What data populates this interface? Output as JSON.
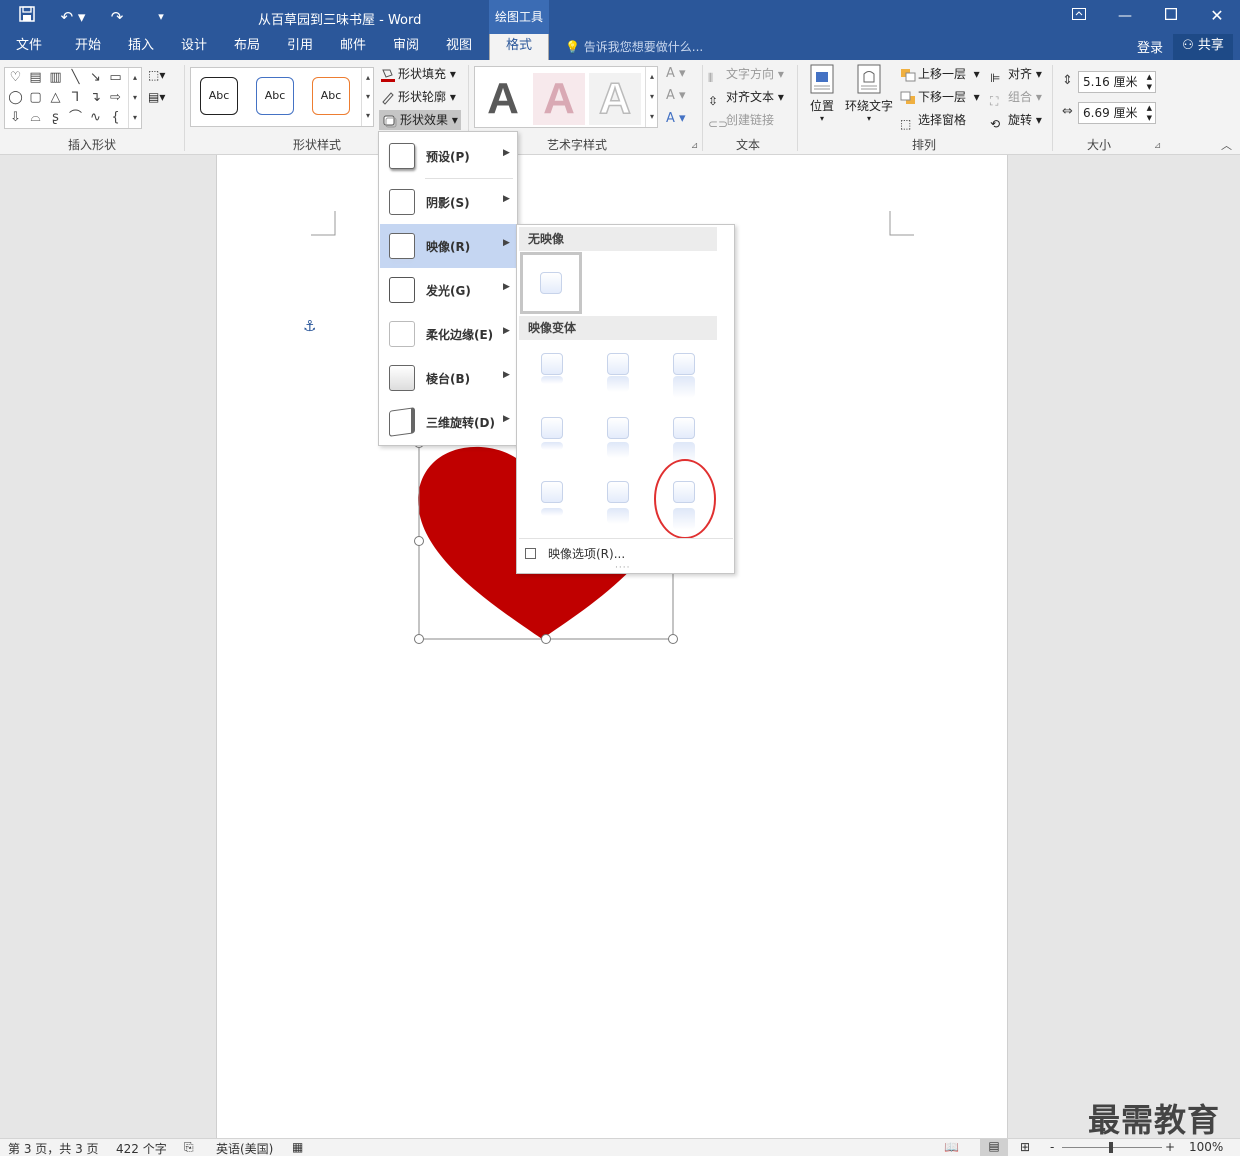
{
  "app": {
    "title": "从百草园到三味书屋 - Word",
    "context_tab_label": "绘图工具",
    "colors": {
      "brand": "#2b579a",
      "heart": "#c00000",
      "menu_highlight": "#c5d6f2",
      "annotation_circle": "#e03030"
    }
  },
  "quick_access": {
    "save_icon": "save-icon",
    "undo_icon": "undo-icon",
    "redo_icon": "redo-icon",
    "customize_icon": "customize-icon"
  },
  "tabs": [
    "文件",
    "开始",
    "插入",
    "设计",
    "布局",
    "引用",
    "邮件",
    "审阅",
    "视图",
    "格式"
  ],
  "tell_me": "告诉我您想要做什么...",
  "login": "登录",
  "share": "共享",
  "ribbon": {
    "insert_shapes": {
      "label": "插入形状"
    },
    "shape_styles": {
      "label": "形状样式",
      "gallery": [
        "Abc",
        "Abc",
        "Abc"
      ],
      "fill": "形状填充",
      "outline": "形状轮廓",
      "effects": "形状效果"
    },
    "wordart": {
      "label": "艺术字样式",
      "letters": [
        "A",
        "A",
        "A"
      ]
    },
    "text": {
      "label": "文本",
      "direction": "文字方向",
      "align": "对齐文本",
      "link": "创建链接"
    },
    "arrange": {
      "label": "排列",
      "position": "位置",
      "wrap": "环绕文字",
      "forward": "上移一层",
      "backward": "下移一层",
      "selection_pane": "选择窗格",
      "align": "对齐",
      "group": "组合",
      "rotate": "旋转"
    },
    "size": {
      "label": "大小",
      "height": "5.16 厘米",
      "width": "6.69 厘米"
    }
  },
  "effects_menu": {
    "items": [
      {
        "label": "预设(P)"
      },
      {
        "label": "阴影(S)"
      },
      {
        "label": "映像(R)",
        "selected": true
      },
      {
        "label": "发光(G)"
      },
      {
        "label": "柔化边缘(E)"
      },
      {
        "label": "棱台(B)"
      },
      {
        "label": "三维旋转(D)"
      }
    ]
  },
  "reflection_panel": {
    "no_reflection_header": "无映像",
    "variants_header": "映像变体",
    "options": "映像选项(R)...",
    "variant_count": 9
  },
  "status": {
    "page": "第 3 页，共 3 页",
    "words": "422 个字",
    "language": "英语(美国)",
    "zoom": "100%",
    "zoom_minus": "-",
    "zoom_plus": "+"
  },
  "watermark": "最需教育"
}
